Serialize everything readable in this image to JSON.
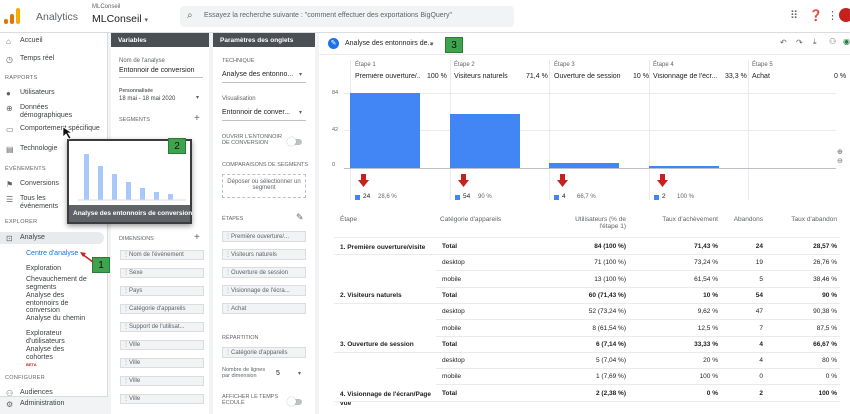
{
  "header": {
    "app_name": "Analytics",
    "account": "MLConseil",
    "property": "MLConseil",
    "search_placeholder": "Essayez la recherche suivante : \"comment effectuer des exportations BigQuery\"",
    "logo_colors": [
      "#f9ab00",
      "#e37400",
      "#e37400"
    ]
  },
  "nav": {
    "items": [
      {
        "icon": "home-icon",
        "label": "Accueil"
      },
      {
        "icon": "clock-icon",
        "label": "Temps réel"
      }
    ],
    "rapports_label": "RAPPORTS",
    "rapports": [
      {
        "icon": "person-icon",
        "label": "Utilisateurs"
      },
      {
        "icon": "globe-icon",
        "label": "Données démographiques"
      },
      {
        "icon": "screen-icon",
        "label": "Comportement spécifique"
      },
      {
        "icon": "tech-icon",
        "label": "Technologie"
      }
    ],
    "evenements_label": "ÉVÉNEMENTS",
    "evenements": [
      {
        "icon": "flag-icon",
        "label": "Conversions"
      },
      {
        "icon": "list-icon",
        "label": "Tous les événements"
      }
    ],
    "explorer_label": "EXPLORER",
    "analyse_label": "Analyse",
    "analyse_sub": [
      "Centre d'analyse",
      "Exploration",
      "Chevauchement de segments",
      "Analyse des entonnoirs de conversion",
      "Analyse du chemin",
      "Explorateur d'utilisateurs",
      "Analyse des cohortes"
    ],
    "beta_label": "BETA",
    "configurer_label": "CONFIGURER",
    "audiences_label": "Audiences",
    "admin_label": "Administration"
  },
  "variables": {
    "title": "Variables",
    "analysis_name_label": "Nom de l'analyse",
    "analysis_name": "Entonnoir de conversion",
    "custom_label": "Personnalisée",
    "date_range": "18 mai - 18 mai 2020",
    "segments_label": "SEGMENTS",
    "dimensions_label": "DIMENSIONS",
    "dimensions": [
      "Nom de l'événement",
      "Sexe",
      "Pays",
      "Catégorie d'appareils",
      "Support de l'utilisat...",
      "Ville",
      "Ville",
      "Ville",
      "Ville"
    ]
  },
  "settings": {
    "title": "Paramètres des onglets",
    "technique_label": "TECHNIQUE",
    "technique_value": "Analyse des entonno...",
    "visualisation_label": "Visualisation",
    "visualisation_value": "Entonnoir de conver...",
    "open_funnel_label": "OUVRIR L'ENTONNOIR DE CONVERSION",
    "segment_comp_label": "COMPARAISONS DE SEGMENTS",
    "segment_drop_text": "Déposer ou sélectionner un segment",
    "etapes_label": "ÉTAPES",
    "etapes": [
      "Première ouverture/...",
      "Visiteurs naturels",
      "Ouverture de session",
      "Visionnage de l'écra...",
      "Achat"
    ],
    "repartition_label": "RÉPARTITION",
    "repartition_value": "Catégorie d'appareils",
    "rows_label": "Nombre de lignes par dimension",
    "rows_value": "5",
    "elapsed_label": "AFFICHER LE TEMPS ÉCOULÉ"
  },
  "tab": {
    "name": "Analyse des entonnoirs de..."
  },
  "callouts": [
    "1",
    "2",
    "3"
  ],
  "popup_caption": "Analyse des entonnoirs de conversion",
  "chart_data": {
    "type": "bar",
    "categories": [
      "Première ouverture/...",
      "Visiteurs naturels",
      "Ouverture de session",
      "Visionnage de l'écr...",
      "Achat"
    ],
    "step_labels": [
      "Étape 1",
      "Étape 2",
      "Étape 3",
      "Étape 4",
      "Étape 5"
    ],
    "step_pcts": [
      "100 %",
      "71,4 %",
      "10 %",
      "33,3 %",
      "0 %"
    ],
    "values": [
      84,
      60,
      6,
      2,
      0
    ],
    "ylim": [
      0,
      84
    ],
    "yticks": [
      "84",
      "42",
      "0"
    ],
    "dropoffs": [
      {
        "count": "24",
        "pct": "28,6 %"
      },
      {
        "count": "54",
        "pct": "90 %"
      },
      {
        "count": "4",
        "pct": "66,7 %"
      },
      {
        "count": "2",
        "pct": "100 %"
      }
    ],
    "bar_color": "#4285f4",
    "arrow_color": "#c5221f"
  },
  "table": {
    "headers": [
      "Étape",
      "Catégorie d'appareils",
      "Utilisateurs (% de l'étape 1)",
      "Taux d'achèvement",
      "Abandons",
      "Taux d'abandon"
    ],
    "rows": [
      {
        "step": "1. Première ouverture/visite",
        "cat": "Total",
        "users": "84 (100 %)",
        "rate": "71,43 %",
        "drops": "24",
        "drop_rate": "28,57 %",
        "bold": true
      },
      {
        "step": "",
        "cat": "desktop",
        "users": "71 (100 %)",
        "rate": "73,24 %",
        "drops": "19",
        "drop_rate": "26,76 %",
        "bold": false
      },
      {
        "step": "",
        "cat": "mobile",
        "users": "13 (100 %)",
        "rate": "61,54 %",
        "drops": "5",
        "drop_rate": "38,46 %",
        "bold": false
      },
      {
        "step": "2. Visiteurs naturels",
        "cat": "Total",
        "users": "60 (71,43 %)",
        "rate": "10 %",
        "drops": "54",
        "drop_rate": "90 %",
        "bold": true
      },
      {
        "step": "",
        "cat": "desktop",
        "users": "52 (73,24 %)",
        "rate": "9,62 %",
        "drops": "47",
        "drop_rate": "90,38 %",
        "bold": false
      },
      {
        "step": "",
        "cat": "mobile",
        "users": "8 (61,54 %)",
        "rate": "12,5 %",
        "drops": "7",
        "drop_rate": "87,5 %",
        "bold": false
      },
      {
        "step": "3. Ouverture de session",
        "cat": "Total",
        "users": "6 (7,14 %)",
        "rate": "33,33 %",
        "drops": "4",
        "drop_rate": "66,67 %",
        "bold": true
      },
      {
        "step": "",
        "cat": "desktop",
        "users": "5 (7,04 %)",
        "rate": "20 %",
        "drops": "4",
        "drop_rate": "80 %",
        "bold": false
      },
      {
        "step": "",
        "cat": "mobile",
        "users": "1 (7,69 %)",
        "rate": "100 %",
        "drops": "0",
        "drop_rate": "0 %",
        "bold": false
      },
      {
        "step": "4. Visionnage de l'écran/Page vue",
        "cat": "Total",
        "users": "2 (2,38 %)",
        "rate": "0 %",
        "drops": "2",
        "drop_rate": "100 %",
        "bold": true
      }
    ]
  }
}
